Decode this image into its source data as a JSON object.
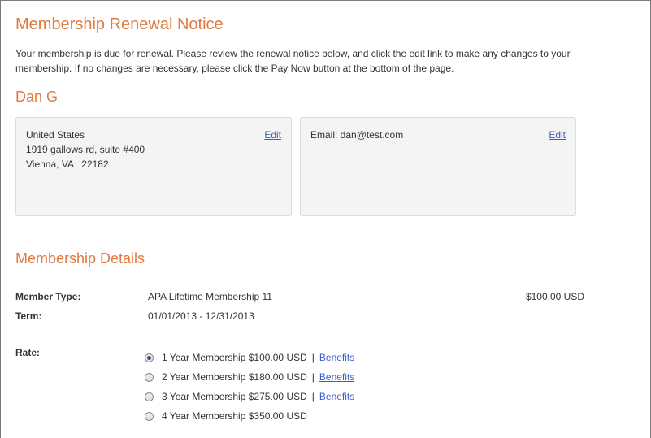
{
  "page": {
    "title": "Membership Renewal Notice",
    "intro": "Your membership is due for renewal. Please review the renewal notice below, and click the edit link to make any changes to your membership. If no changes are necessary, please click the Pay Now button at the bottom of the page."
  },
  "member": {
    "name": "Dan G"
  },
  "address_card": {
    "country": "United States",
    "street": "1919 gallows rd, suite #400",
    "city_state_zip": "Vienna, VA   22182",
    "edit_label": "Edit"
  },
  "contact_card": {
    "email_line": "Email: dan@test.com",
    "edit_label": "Edit"
  },
  "details": {
    "section_title": "Membership Details",
    "member_type_label": "Member Type:",
    "member_type_value": "APA Lifetime Membership 11",
    "price": "$100.00 USD",
    "term_label": "Term:",
    "term_value": "01/01/2013 - 12/31/2013",
    "rate_label": "Rate:",
    "rates": [
      {
        "label": "1 Year Membership $100.00 USD",
        "benefits": "Benefits",
        "selected": true
      },
      {
        "label": "2 Year Membership $180.00 USD",
        "benefits": "Benefits",
        "selected": false
      },
      {
        "label": "3 Year Membership $275.00 USD",
        "benefits": "Benefits",
        "selected": false
      },
      {
        "label": "4 Year Membership $350.00 USD",
        "selected": false
      }
    ],
    "separator": "|"
  },
  "colors": {
    "accent": "#e07a3f",
    "link": "#3a5fcd",
    "card_bg": "#f4f4f4"
  }
}
